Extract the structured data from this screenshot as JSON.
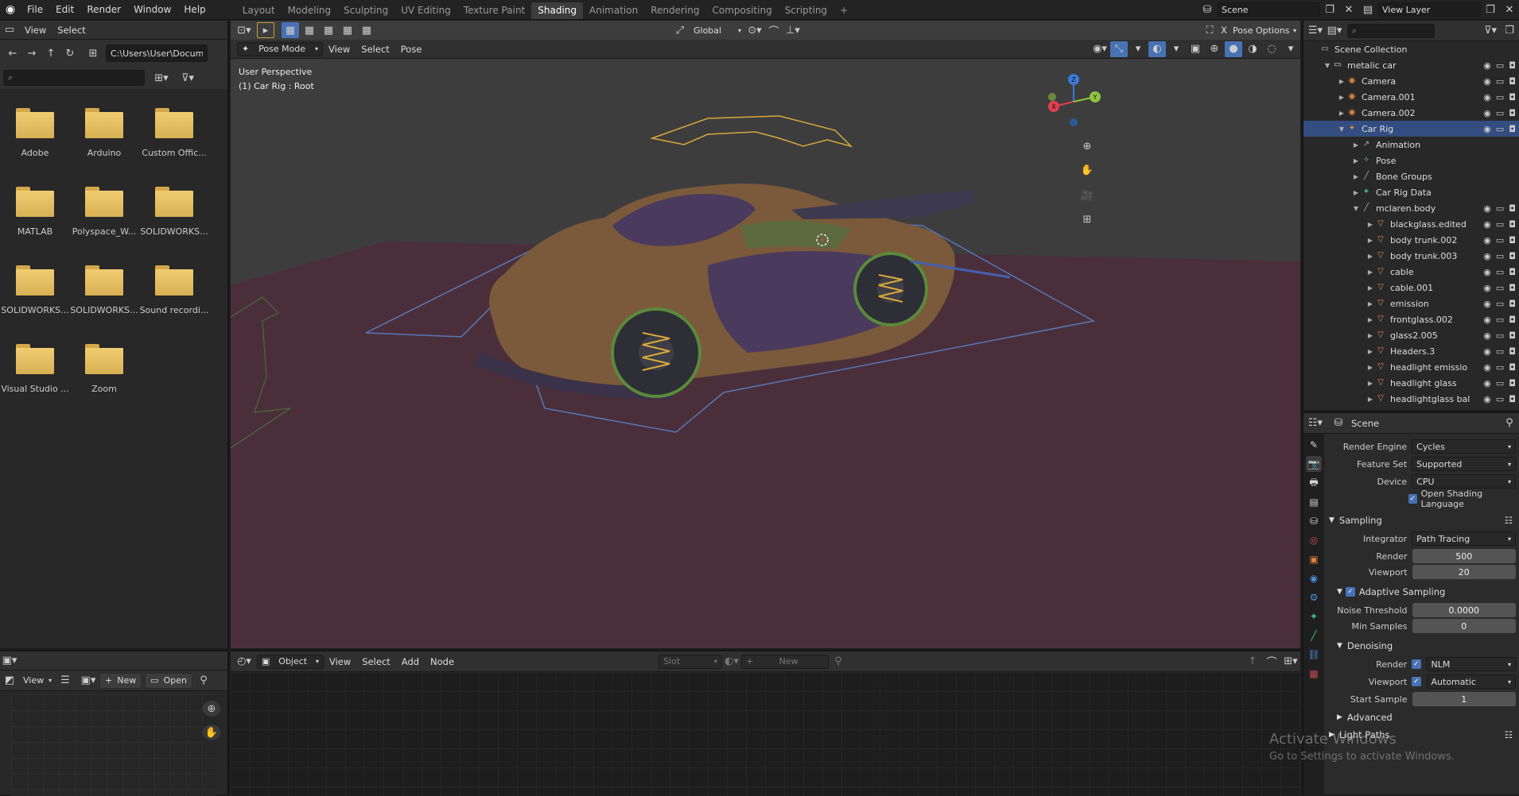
{
  "topbar": {
    "menus": [
      "File",
      "Edit",
      "Render",
      "Window",
      "Help"
    ],
    "workspaces": [
      "Layout",
      "Modeling",
      "Sculpting",
      "UV Editing",
      "Texture Paint",
      "Shading",
      "Animation",
      "Rendering",
      "Compositing",
      "Scripting"
    ],
    "active_workspace": "Shading",
    "scene": "Scene",
    "view_layer": "View Layer"
  },
  "filebrowser": {
    "menus": [
      "View",
      "Select"
    ],
    "path": "C:\\Users\\User\\Docum...",
    "folders": [
      "Adobe",
      "Arduino",
      "Custom Offic...",
      "MATLAB",
      "Polyspace_W...",
      "SOLIDWORKS...",
      "SOLIDWORKS...",
      "SOLIDWORKS...",
      "Sound recordi...",
      "Visual Studio ...",
      "Zoom"
    ]
  },
  "image_editor": {
    "view": "View",
    "new": "New",
    "open": "Open"
  },
  "viewport": {
    "mode": "Pose Mode",
    "menus": [
      "View",
      "Select",
      "Pose"
    ],
    "orientation": "Global",
    "pose_options": "Pose Options",
    "info_line1": "User Perspective",
    "info_line2": "(1) Car Rig : Root"
  },
  "node_editor": {
    "object": "Object",
    "menus": [
      "View",
      "Select",
      "Add",
      "Node"
    ],
    "slot": "Slot",
    "new": "New"
  },
  "outliner": {
    "root": "Scene Collection",
    "rows": [
      {
        "label": "metalic car",
        "indent": 1,
        "icon": "collection",
        "sel": false
      },
      {
        "label": "Camera",
        "indent": 2,
        "icon": "camera",
        "sel": false
      },
      {
        "label": "Camera.001",
        "indent": 2,
        "icon": "camera",
        "sel": false
      },
      {
        "label": "Camera.002",
        "indent": 2,
        "icon": "camera",
        "sel": false
      },
      {
        "label": "Car Rig",
        "indent": 2,
        "icon": "armature",
        "sel": true
      },
      {
        "label": "Animation",
        "indent": 3,
        "icon": "anim",
        "sel": false
      },
      {
        "label": "Pose",
        "indent": 3,
        "icon": "pose",
        "sel": false
      },
      {
        "label": "Bone Groups",
        "indent": 3,
        "icon": "bone",
        "sel": false
      },
      {
        "label": "Car Rig Data",
        "indent": 3,
        "icon": "armdata",
        "sel": false
      },
      {
        "label": "mclaren.body",
        "indent": 3,
        "icon": "bone",
        "sel": false
      },
      {
        "label": "blackglass.edited",
        "indent": 4,
        "icon": "mesh",
        "sel": false
      },
      {
        "label": "body trunk.002",
        "indent": 4,
        "icon": "mesh",
        "sel": false
      },
      {
        "label": "body trunk.003",
        "indent": 4,
        "icon": "mesh",
        "sel": false
      },
      {
        "label": "cable",
        "indent": 4,
        "icon": "mesh",
        "sel": false
      },
      {
        "label": "cable.001",
        "indent": 4,
        "icon": "mesh",
        "sel": false
      },
      {
        "label": "emission",
        "indent": 4,
        "icon": "mesh",
        "sel": false
      },
      {
        "label": "frontglass.002",
        "indent": 4,
        "icon": "mesh",
        "sel": false
      },
      {
        "label": "glass2.005",
        "indent": 4,
        "icon": "mesh",
        "sel": false
      },
      {
        "label": "Headers.3",
        "indent": 4,
        "icon": "mesh",
        "sel": false
      },
      {
        "label": "headlight emissio",
        "indent": 4,
        "icon": "mesh",
        "sel": false
      },
      {
        "label": "headlight glass",
        "indent": 4,
        "icon": "mesh",
        "sel": false
      },
      {
        "label": "headlightglass bal",
        "indent": 4,
        "icon": "mesh",
        "sel": false
      }
    ]
  },
  "properties": {
    "context": "Scene",
    "render_engine_label": "Render Engine",
    "render_engine": "Cycles",
    "feature_set_label": "Feature Set",
    "feature_set": "Supported",
    "device_label": "Device",
    "device": "CPU",
    "osl": "Open Shading Language",
    "sampling": "Sampling",
    "integrator_label": "Integrator",
    "integrator": "Path Tracing",
    "render_label": "Render",
    "render_samples": "500",
    "viewport_label": "Viewport",
    "viewport_samples": "20",
    "adaptive": "Adaptive Sampling",
    "noise_label": "Noise Threshold",
    "noise": "0.0000",
    "min_label": "Min Samples",
    "min": "0",
    "denoising": "Denoising",
    "den_render_label": "Render",
    "den_render": "NLM",
    "den_viewport_label": "Viewport",
    "den_viewport": "Automatic",
    "start_label": "Start Sample",
    "start": "1",
    "advanced": "Advanced",
    "light_paths": "Light Paths"
  },
  "watermark": {
    "line1": "Activate Windows",
    "line2": "Go to Settings to activate Windows."
  }
}
